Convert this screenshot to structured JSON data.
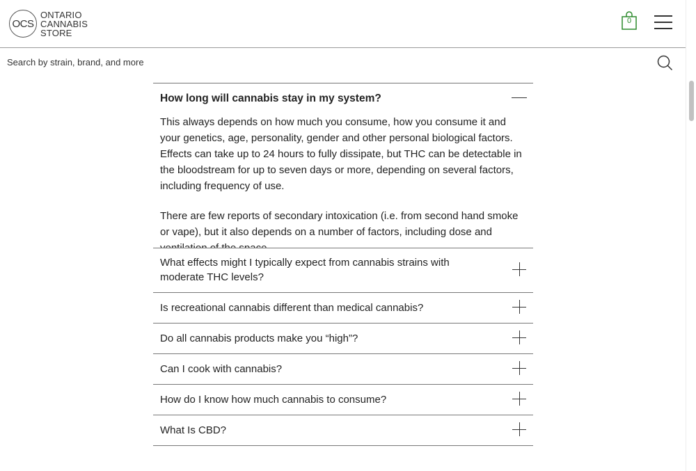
{
  "header": {
    "logo": {
      "mark": "OCS",
      "line1": "ONTARIO",
      "line2": "CANNABIS",
      "line3": "STORE"
    },
    "cart_count": "0",
    "cart_icon": "shopping-bag-icon",
    "menu_icon": "hamburger-menu-icon",
    "accent_color": "#2c8a2c"
  },
  "search": {
    "placeholder": "Search by strain, brand, and more",
    "icon": "search-icon"
  },
  "faq": {
    "open": {
      "question": "How long will cannabis stay in my system?",
      "answer_p1": "This always depends on how much you consume, how you consume it and your genetics, age, personality, gender and other personal biological factors. Effects can take up to 24 hours to fully dissipate, but THC can be detectable in the bloodstream for up to seven days or more, depending on several factors, including frequency of use.",
      "answer_p2": "There are few reports of secondary intoxication (i.e. from second hand smoke or vape), but it also depends on a number of factors, including dose and ventilation of the space."
    },
    "items": [
      {
        "question": "What effects might I typically expect from cannabis strains with moderate THC levels?"
      },
      {
        "question": "Is recreational cannabis different than medical cannabis?"
      },
      {
        "question": "Do all cannabis products make you “high”?"
      },
      {
        "question": "Can I cook with cannabis?"
      },
      {
        "question": "How do I know how much cannabis to consume?"
      },
      {
        "question": "What Is CBD?"
      }
    ]
  }
}
